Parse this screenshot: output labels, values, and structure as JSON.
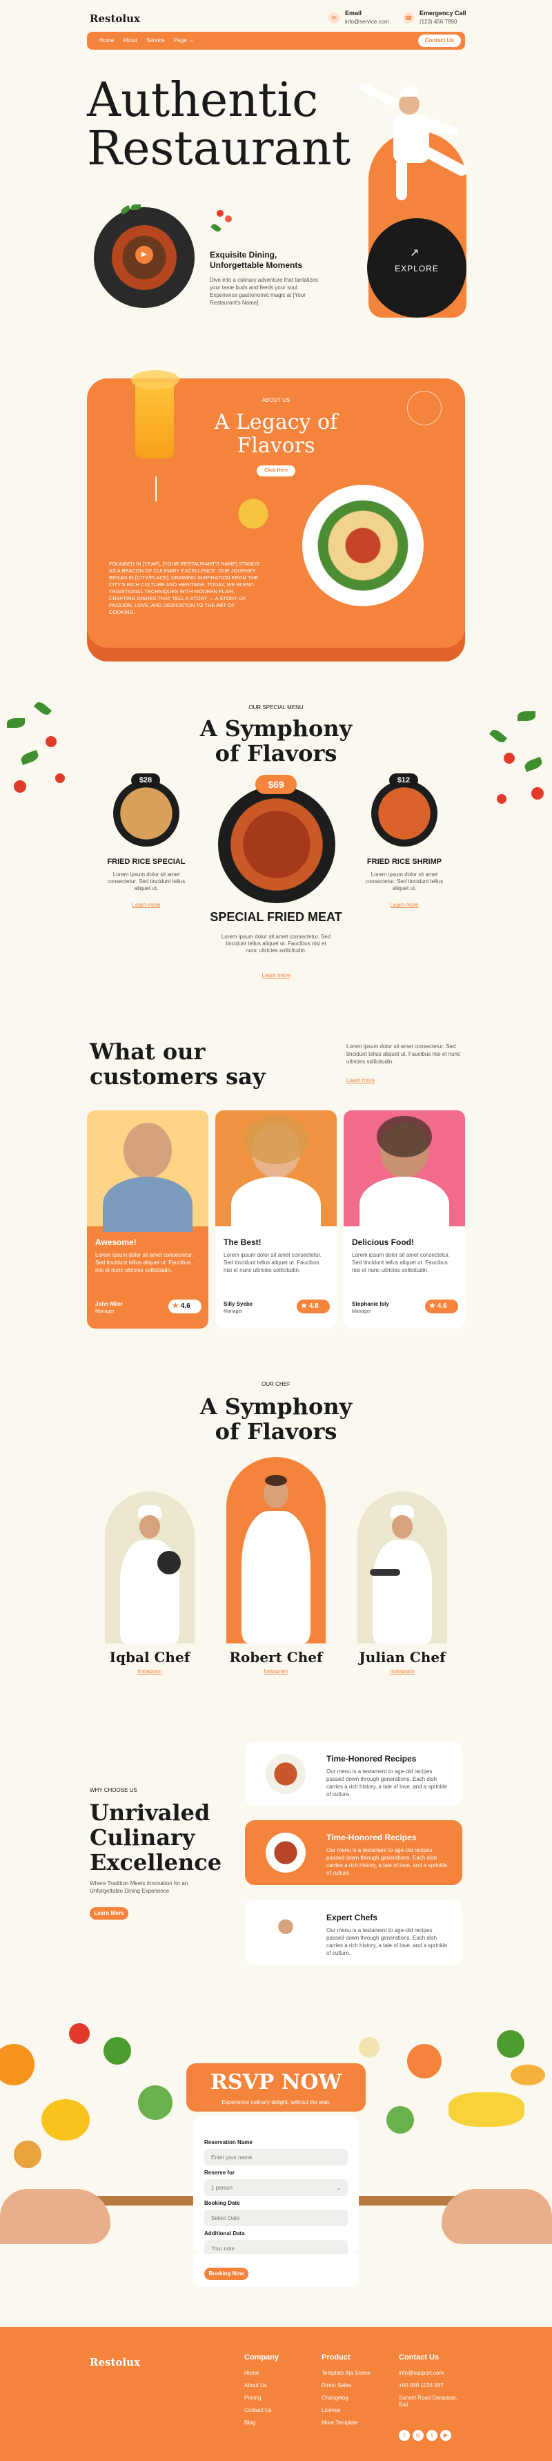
{
  "header": {
    "logo": "Restolux",
    "email_label": "Email",
    "email_value": "info@service.com",
    "call_label": "Emergency Call",
    "call_value": "(123) 456 7890",
    "nav": [
      "Home",
      "About",
      "Service",
      "Page"
    ],
    "contact_btn": "Contact Us"
  },
  "hero": {
    "title_line1": "Authentic",
    "title_line2": "Restaurant",
    "sub_title": "Exquisite Dining, Unforgettable Moments",
    "sub_text": "Dive into a culinary adventure that tantalizes your taste buds and feeds your soul. Experience gastronomic magic at [Your Restaurant's Name].",
    "explore": "EXPLORE"
  },
  "about": {
    "eyebrow": "ABOUT US",
    "title_line1": "A Legacy of",
    "title_line2": "Flavors",
    "btn": "Click Here",
    "body": "FOUNDED IN [YEAR], [YOUR RESTAURANT'S NAME] STANDS AS A BEACON OF CULINARY EXCELLENCE. OUR JOURNEY BEGAN IN [CITY/PLACE], DRAWING INSPIRATION FROM THE CITY'S RICH CULTURE AND HERITAGE. TODAY, WE BLEND TRADITIONAL TECHNIQUES WITH MODERN FLAIR, CRAFTING DISHES THAT TELL A STORY — A STORY OF PASSION, LOVE, AND DEDICATION TO THE ART OF COOKING."
  },
  "menu": {
    "eyebrow": "OUR SPECIAL MENU",
    "title_line1": "A Symphony",
    "title_line2": "of Flavors",
    "items": [
      {
        "price": "$28",
        "name": "FRIED RICE SPECIAL",
        "desc": "Lorem ipsum dolor sit amet consectetur. Sed tincidunt tellus aliquet ut.",
        "link": "Learn more"
      },
      {
        "price": "$69",
        "name": "SPECIAL FRIED MEAT",
        "desc": "Lorem ipsum dolor sit amet consectetur. Sed tincidunt tellus aliquet ut. Faucibus nisi et nunc ultricies sollicitudin.",
        "link": "Learn more"
      },
      {
        "price": "$12",
        "name": "FRIED RICE SHRIMP",
        "desc": "Lorem ipsum dolor sit amet consectetur. Sed tincidunt tellus aliquet ut.",
        "link": "Learn more"
      }
    ]
  },
  "testimonials": {
    "title_line1": "What our",
    "title_line2": "customers say",
    "intro": "Lorem ipsum dolor sit amet consectetur. Sed tincidunt tellus aliquet ut. Faucibus nisi et nunc ultricies sollicitudin.",
    "link": "Learn more",
    "cards": [
      {
        "title": "Awesome!",
        "text": "Lorem ipsum dolor sit amet consectetur. Sed tincidunt tellus aliquet ut. Faucibus nisi et nunc ultricies sollicitudin.",
        "name": "John Miler",
        "role": "Manager",
        "rating": "4.6"
      },
      {
        "title": "The Best!",
        "text": "Lorem ipsum dolor sit amet consectetur. Sed tincidunt tellus aliquet ut. Faucibus nisi et nunc ultricies sollicitudin.",
        "name": "Silly Syebe",
        "role": "Manager",
        "rating": "4.8"
      },
      {
        "title": "Delicious Food!",
        "text": "Lorem ipsum dolor sit amet consectetur. Sed tincidunt tellus aliquet ut. Faucibus nisi et nunc ultricies sollicitudin.",
        "name": "Stephanie Isly",
        "role": "Manager",
        "rating": "4.6"
      }
    ]
  },
  "chefs": {
    "eyebrow": "OUR CHEF",
    "title_line1": "A Symphony",
    "title_line2": "of Flavors",
    "list": [
      {
        "name": "Iqbal Chef",
        "link": "Instagram"
      },
      {
        "name": "Robert Chef",
        "link": "Instagram"
      },
      {
        "name": "Julian Chef",
        "link": "Instagram"
      }
    ]
  },
  "why": {
    "eyebrow": "WHY CHOOSE US",
    "title_line1": "Unrivaled",
    "title_line2": "Culinary",
    "title_line3": "Excellence",
    "sub": "Where Tradition Meets Innovation for an Unforgettable Dining Experience",
    "btn": "Learn More",
    "features": [
      {
        "title": "Time-Honored Recipes",
        "text": "Our menu is a testament to age-old recipes passed down through generations. Each dish carries a rich history, a tale of love, and a sprinkle of culture."
      },
      {
        "title": "Time-Honored Recipes",
        "text": "Our menu is a testament to age-old recipes passed down through generations. Each dish carries a rich history, a tale of love, and a sprinkle of culture."
      },
      {
        "title": "Expert Chefs",
        "text": "Our menu is a testament to age-old recipes passed down through generations. Each dish carries a rich history, a tale of love, and a sprinkle of culture."
      }
    ]
  },
  "rsvp": {
    "title": "RSVP NOW",
    "sub": "Experience culinary delight, without the wait.",
    "name_label": "Reservation Name",
    "name_ph": "Enter your name",
    "reserve_label": "Reserve for",
    "reserve_val": "1 person",
    "date_label": "Booking Date",
    "date_ph": "Select Date",
    "notes_label": "Additional Data",
    "notes_ph": "Your note",
    "btn": "Booking Now"
  },
  "footer": {
    "logo": "Restolux",
    "company_h": "Company",
    "company": [
      "Home",
      "About Us",
      "Pricing",
      "Contact Us",
      "Blog"
    ],
    "product_h": "Product",
    "product": [
      "Template Aja Scene",
      "Direct Sales",
      "Changelog",
      "License",
      "More Template"
    ],
    "contact_h": "Contact Us",
    "contact": [
      "info@support.com",
      "+00 000 1234 567",
      "Sunset Road Denpasar, Bali"
    ]
  }
}
